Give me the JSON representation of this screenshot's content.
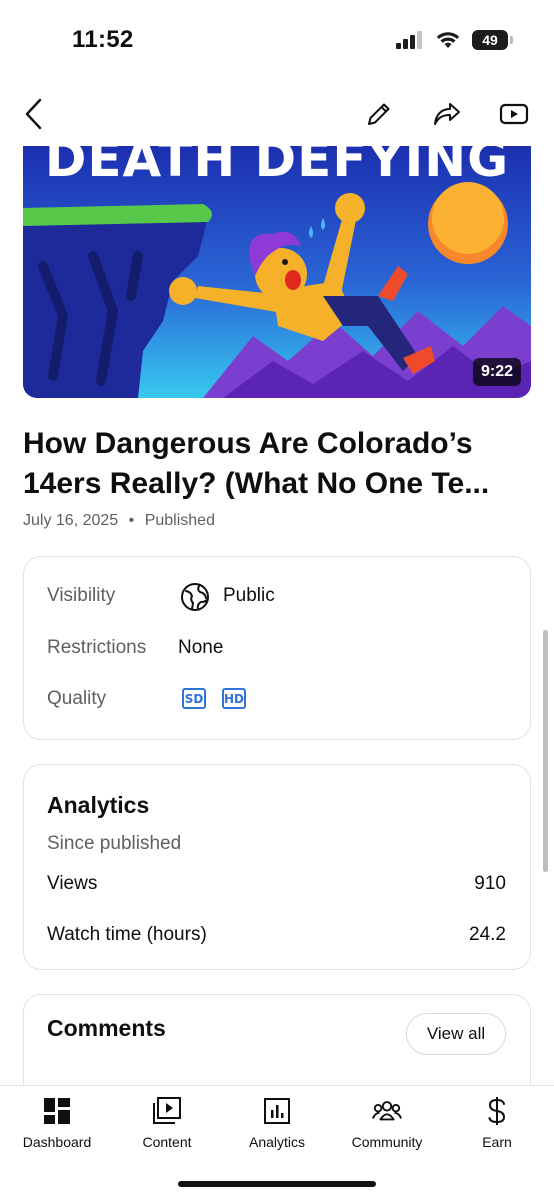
{
  "status_bar": {
    "time": "11:52",
    "battery": "49"
  },
  "video": {
    "thumbnail_text": "DEATH DEFYING",
    "duration": "9:22",
    "title": "How Dangerous Are Colorado’s 14ers Really? (What No One Te...",
    "date": "July 16, 2025",
    "separator": "•",
    "status": "Published"
  },
  "details": {
    "visibility_label": "Visibility",
    "visibility_value": "Public",
    "restrictions_label": "Restrictions",
    "restrictions_value": "None",
    "quality_label": "Quality",
    "quality_badges": [
      "SD",
      "HD"
    ]
  },
  "analytics": {
    "title": "Analytics",
    "subtitle": "Since published",
    "stats": [
      {
        "label": "Views",
        "value": "910"
      },
      {
        "label": "Watch time (hours)",
        "value": "24.2"
      }
    ]
  },
  "comments": {
    "title": "Comments",
    "view_all": "View all"
  },
  "bottom_nav": {
    "items": [
      {
        "label": "Dashboard",
        "icon": "dashboard-icon"
      },
      {
        "label": "Content",
        "icon": "content-icon"
      },
      {
        "label": "Analytics",
        "icon": "analytics-icon"
      },
      {
        "label": "Community",
        "icon": "community-icon"
      },
      {
        "label": "Earn",
        "icon": "earn-icon"
      }
    ]
  },
  "colors": {
    "accent_blue": "#2f72d8",
    "secondary_text": "#606060"
  }
}
